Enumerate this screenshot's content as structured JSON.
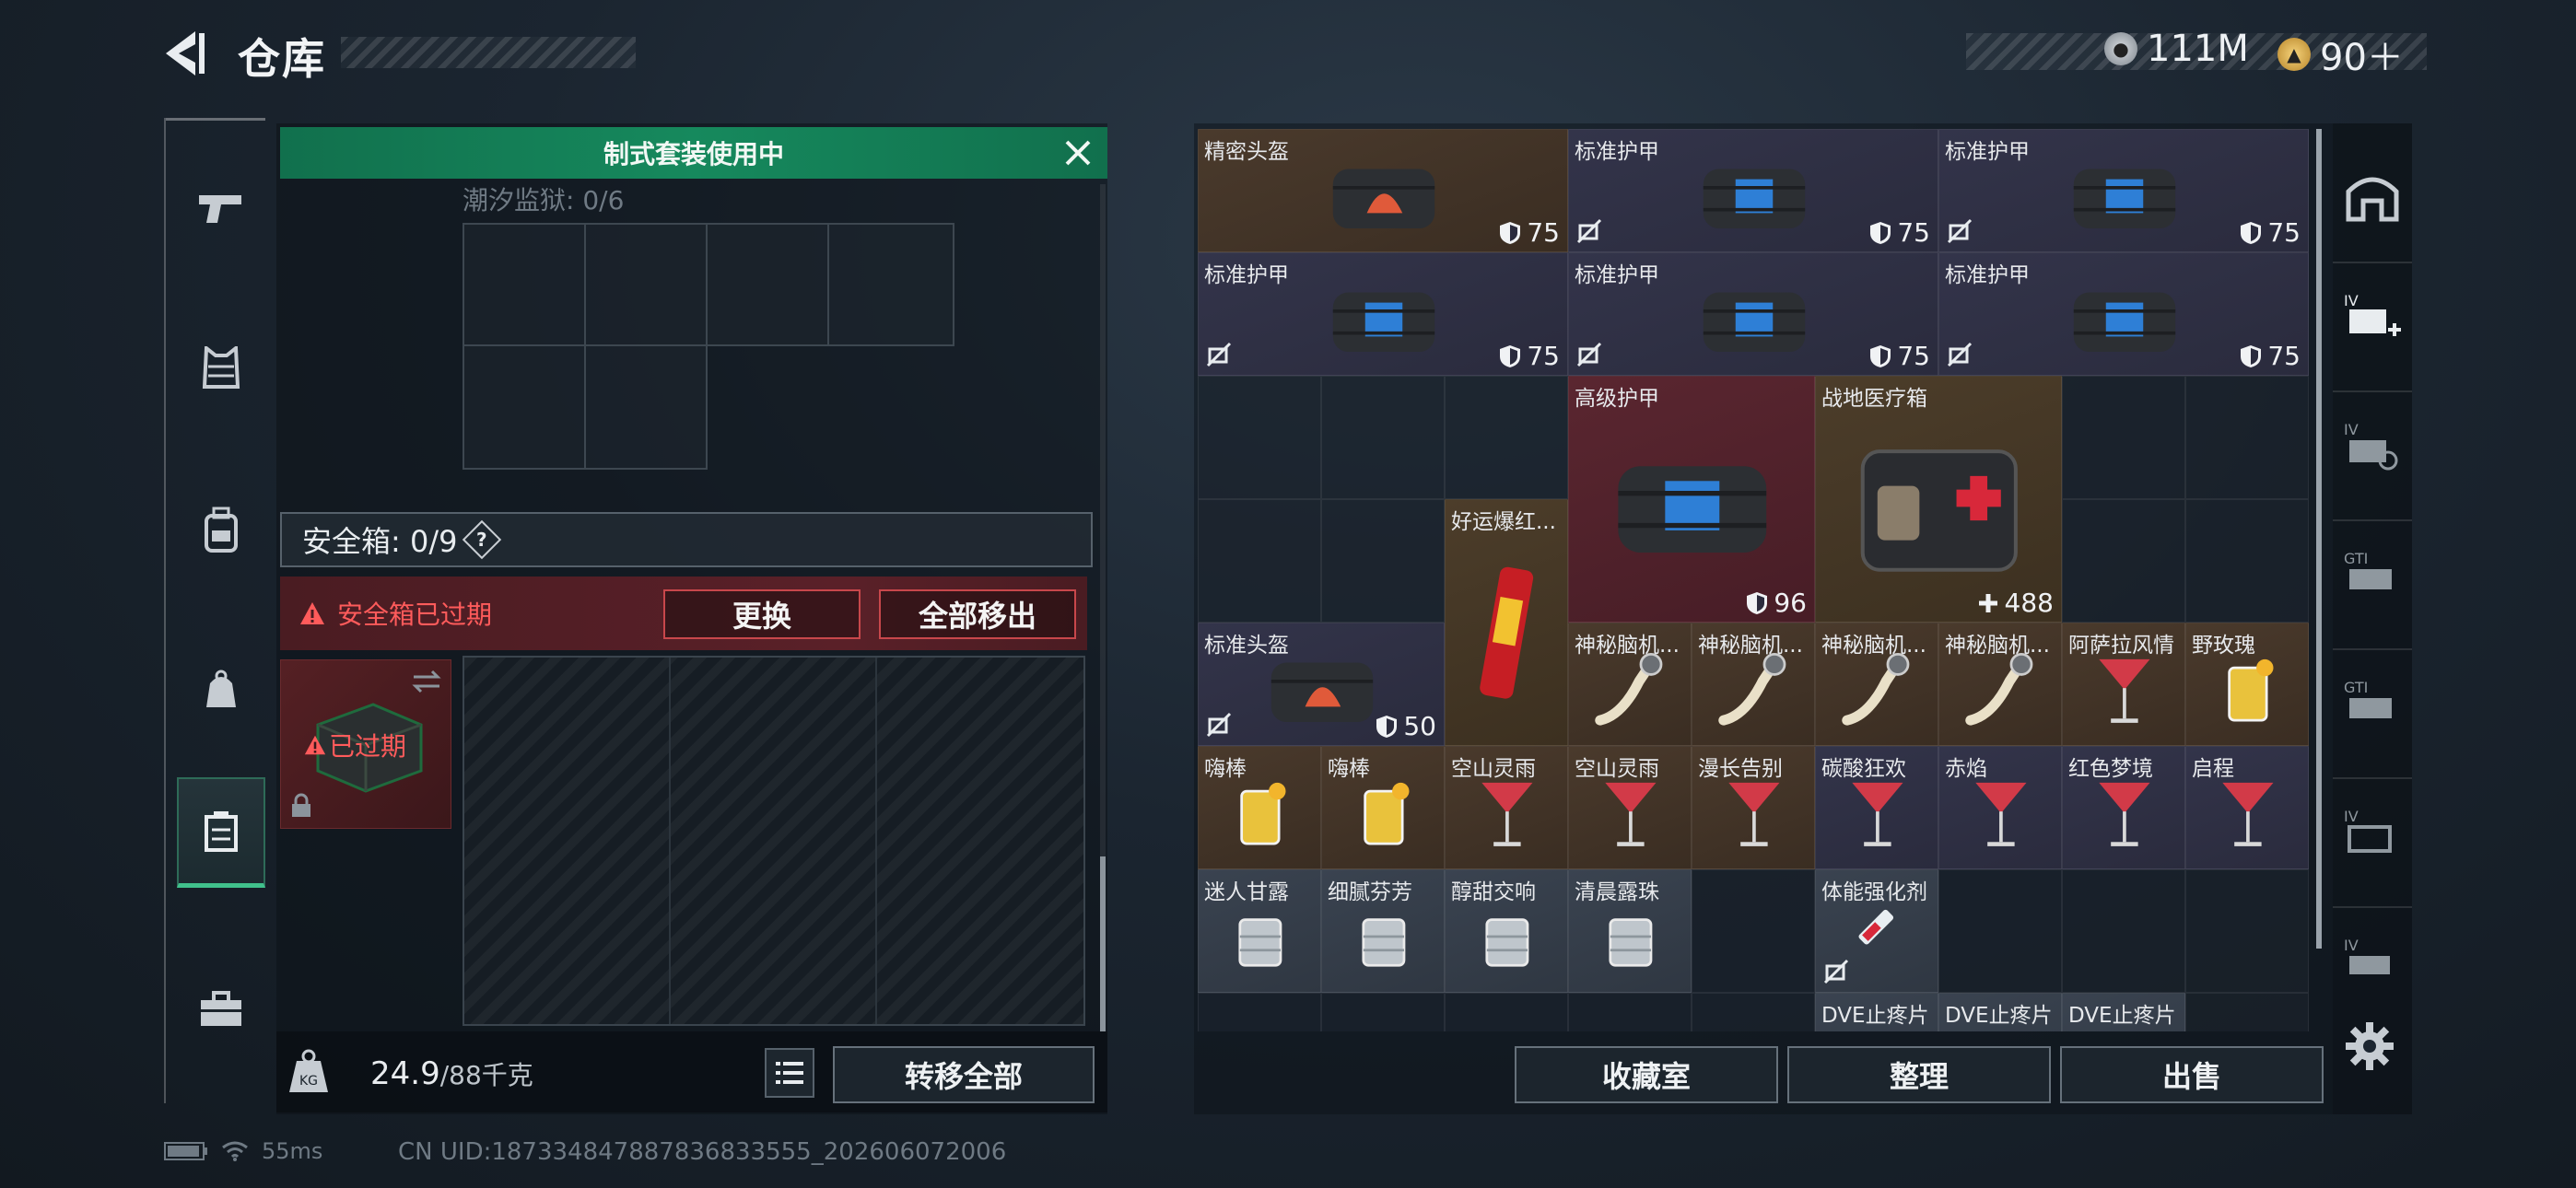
{
  "header": {
    "title": "仓库",
    "currency_silver": "111M",
    "currency_gold": "90＋"
  },
  "colors": {
    "accent_green": "#40c18c",
    "kit_bar": "#16895d",
    "expired_red": "#ff5b5b"
  },
  "left_nav": [
    "pistol-icon",
    "armor-vest-icon",
    "backpack-icon",
    "chest-rig-icon",
    "safe-box-icon",
    "toolbox-icon"
  ],
  "left_panel": {
    "kit_banner": "制式套装使用中",
    "tide_prison": "潮汐监狱: 0/6",
    "safebox_label": "安全箱: 0/9",
    "safebox_help": "?",
    "expired_notice": "安全箱已过期",
    "replace_button": "更换",
    "remove_all_button": "全部移出",
    "expired_tag": "已过期",
    "weight_current": "24.9",
    "weight_max": "/88千克",
    "transfer_all_button": "转移全部"
  },
  "stash": {
    "items": [
      {
        "name": "精密头盔",
        "value": "75"
      },
      {
        "name": "标准护甲",
        "value": "75"
      },
      {
        "name": "标准护甲",
        "value": "75"
      },
      {
        "name": "标准护甲",
        "value": "75"
      },
      {
        "name": "标准护甲",
        "value": "75"
      },
      {
        "name": "标准护甲",
        "value": "75"
      },
      {
        "name": "高级护甲",
        "value": "96"
      },
      {
        "name": "战地医疗箱",
        "value": "488"
      },
      {
        "name": "好运爆红..."
      },
      {
        "name": "标准头盔",
        "value": "50"
      },
      {
        "name": "神秘脑机..."
      },
      {
        "name": "神秘脑机..."
      },
      {
        "name": "神秘脑机..."
      },
      {
        "name": "神秘脑机..."
      },
      {
        "name": "阿萨拉风情"
      },
      {
        "name": "野玫瑰"
      },
      {
        "name": "嗨棒"
      },
      {
        "name": "嗨棒"
      },
      {
        "name": "空山灵雨"
      },
      {
        "name": "空山灵雨"
      },
      {
        "name": "漫长告别"
      },
      {
        "name": "碳酸狂欢"
      },
      {
        "name": "赤焰"
      },
      {
        "name": "红色梦境"
      },
      {
        "name": "启程"
      },
      {
        "name": "迷人甘露"
      },
      {
        "name": "细腻芬芳"
      },
      {
        "name": "醇甜交响"
      },
      {
        "name": "清晨露珠"
      },
      {
        "name": "体能强化剂"
      },
      {
        "name": "DVE止疼片"
      },
      {
        "name": "DVE止疼片"
      },
      {
        "name": "DVE止疼片"
      }
    ],
    "collection_button": "收藏室",
    "sort_button": "整理",
    "sell_button": "出售"
  },
  "right_nav": [
    "hideout-icon",
    "add-storage-icon",
    "storage-iv-icon",
    "storage-gti-icon",
    "storage-gti-2-icon",
    "storage-iv-2-icon",
    "storage-iv-3-icon"
  ],
  "status": {
    "ping": "55ms",
    "uid": "CN UID:187334847887836833555_202606072006"
  }
}
